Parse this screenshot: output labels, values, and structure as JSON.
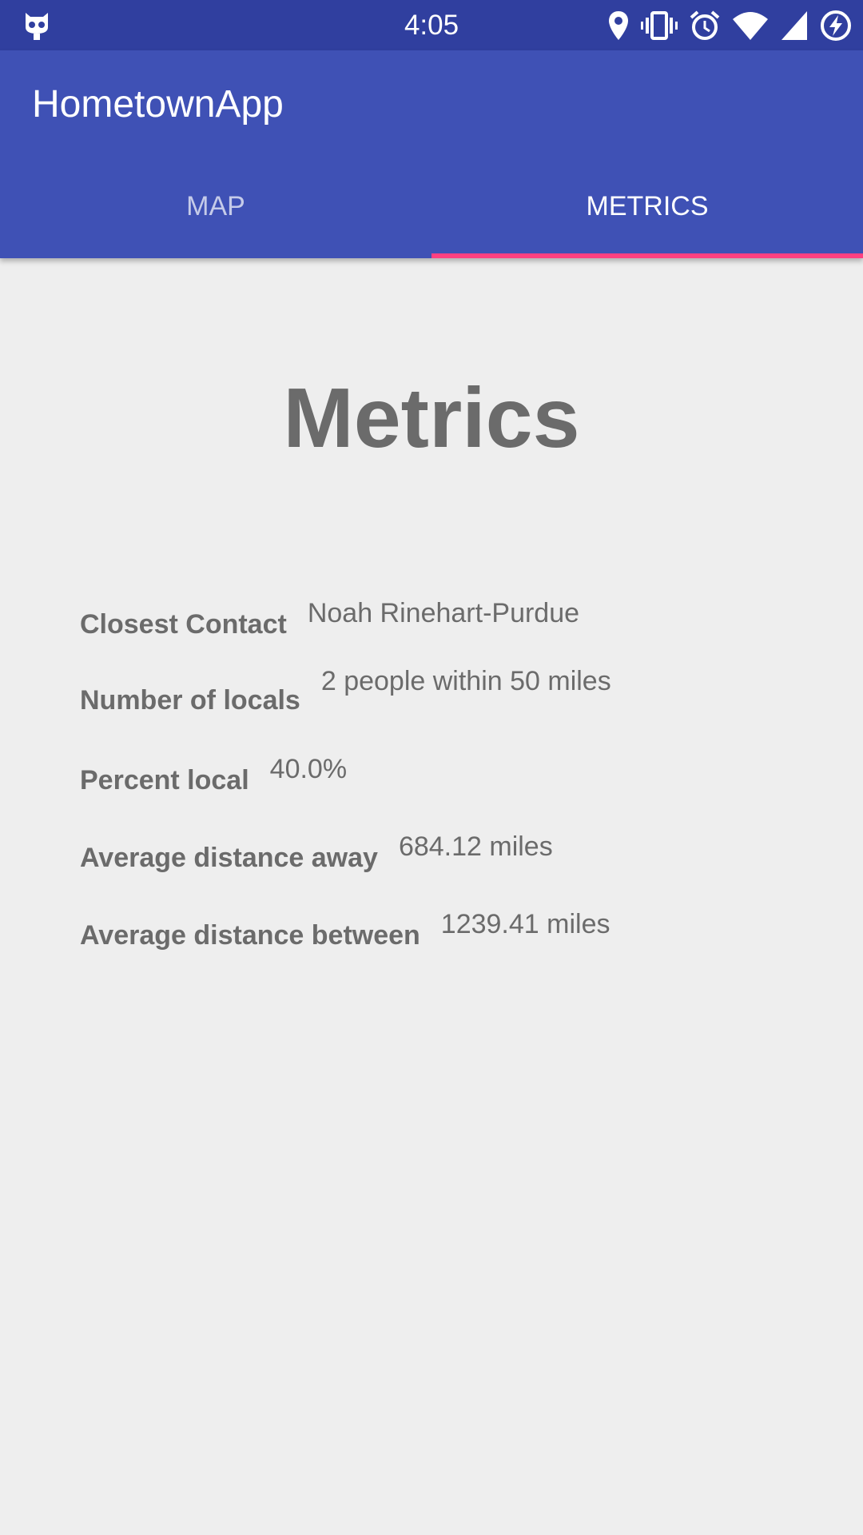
{
  "status_bar": {
    "time": "4:05",
    "icons": [
      "cyanogen-icon",
      "location-icon",
      "vibrate-icon",
      "alarm-icon",
      "wifi-icon",
      "signal-icon",
      "battery-charging-icon"
    ]
  },
  "app": {
    "title": "HometownApp"
  },
  "tabs": [
    {
      "label": "MAP",
      "active": false
    },
    {
      "label": "METRICS",
      "active": true
    }
  ],
  "colors": {
    "status_bar": "#303f9f",
    "app_bar": "#3f51b5",
    "tab_indicator": "#ff4081",
    "background": "#eeeeee",
    "text": "#6b6b6b"
  },
  "page": {
    "heading": "Metrics"
  },
  "metrics": [
    {
      "label": "Closest Contact",
      "value": "Noah Rinehart-Purdue"
    },
    {
      "label": "Number of locals",
      "value": "2 people within 50 miles"
    },
    {
      "label": "Percent local",
      "value": "40.0%"
    },
    {
      "label": "Average distance away",
      "value": "684.12 miles"
    },
    {
      "label": "Average distance between",
      "value": "1239.41 miles"
    }
  ]
}
